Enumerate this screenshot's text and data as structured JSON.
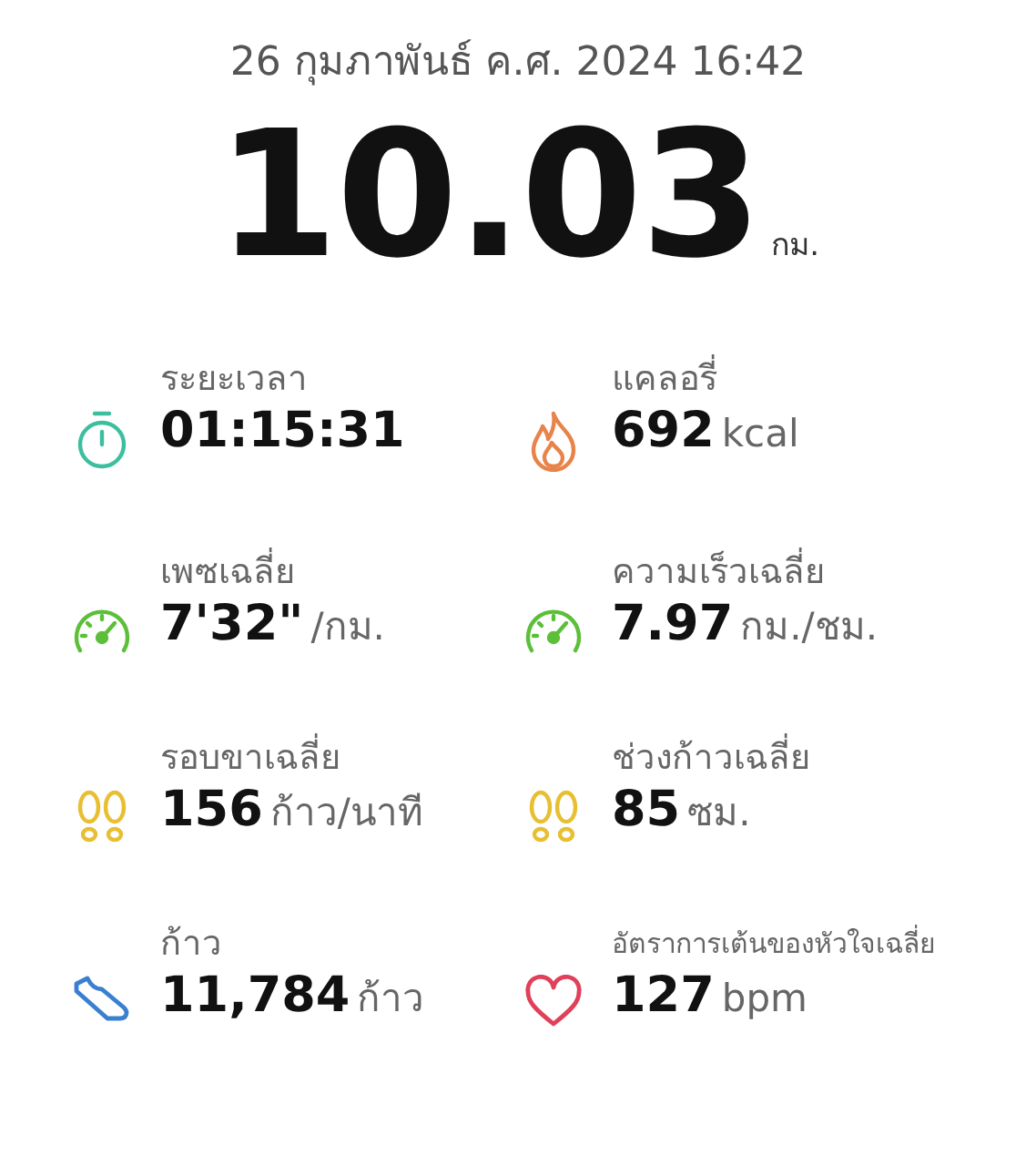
{
  "date": "26 กุมภาพันธ์ ค.ศ. 2024 16:42",
  "distance": {
    "value": "10.03",
    "unit": "กม."
  },
  "stats": [
    {
      "kind": "timer",
      "color": "#3dbf9f",
      "label": "ระยะเวลา",
      "value": "01:15:31"
    },
    {
      "kind": "flame",
      "color": "#e8834a",
      "label": "แคลอรี่",
      "value": "692",
      "unit": "kcal"
    },
    {
      "kind": "gauge",
      "color": "#5cbf3a",
      "label": "เพซเฉลี่ย",
      "value": "7'32\"",
      "unit": "/กม."
    },
    {
      "kind": "gauge",
      "color": "#5cbf3a",
      "label": "ความเร็วเฉลี่ย",
      "value": "7.97",
      "unit": "กม./ชม."
    },
    {
      "kind": "steps",
      "color": "#e8bf32",
      "label": "รอบขาเฉลี่ย",
      "value": "156",
      "unit": "ก้าว/นาที"
    },
    {
      "kind": "steps",
      "color": "#e8bf32",
      "label": "ช่วงก้าวเฉลี่ย",
      "value": "85",
      "unit": "ซม."
    },
    {
      "kind": "shoe",
      "color": "#3a7fd0",
      "label": "ก้าว",
      "value": "11,784",
      "unit": "ก้าว"
    },
    {
      "kind": "heart",
      "color": "#e0405a",
      "label": "อัตราการเต้นของหัวใจเฉลี่ย",
      "value": "127",
      "unit": "bpm",
      "small": true
    }
  ]
}
